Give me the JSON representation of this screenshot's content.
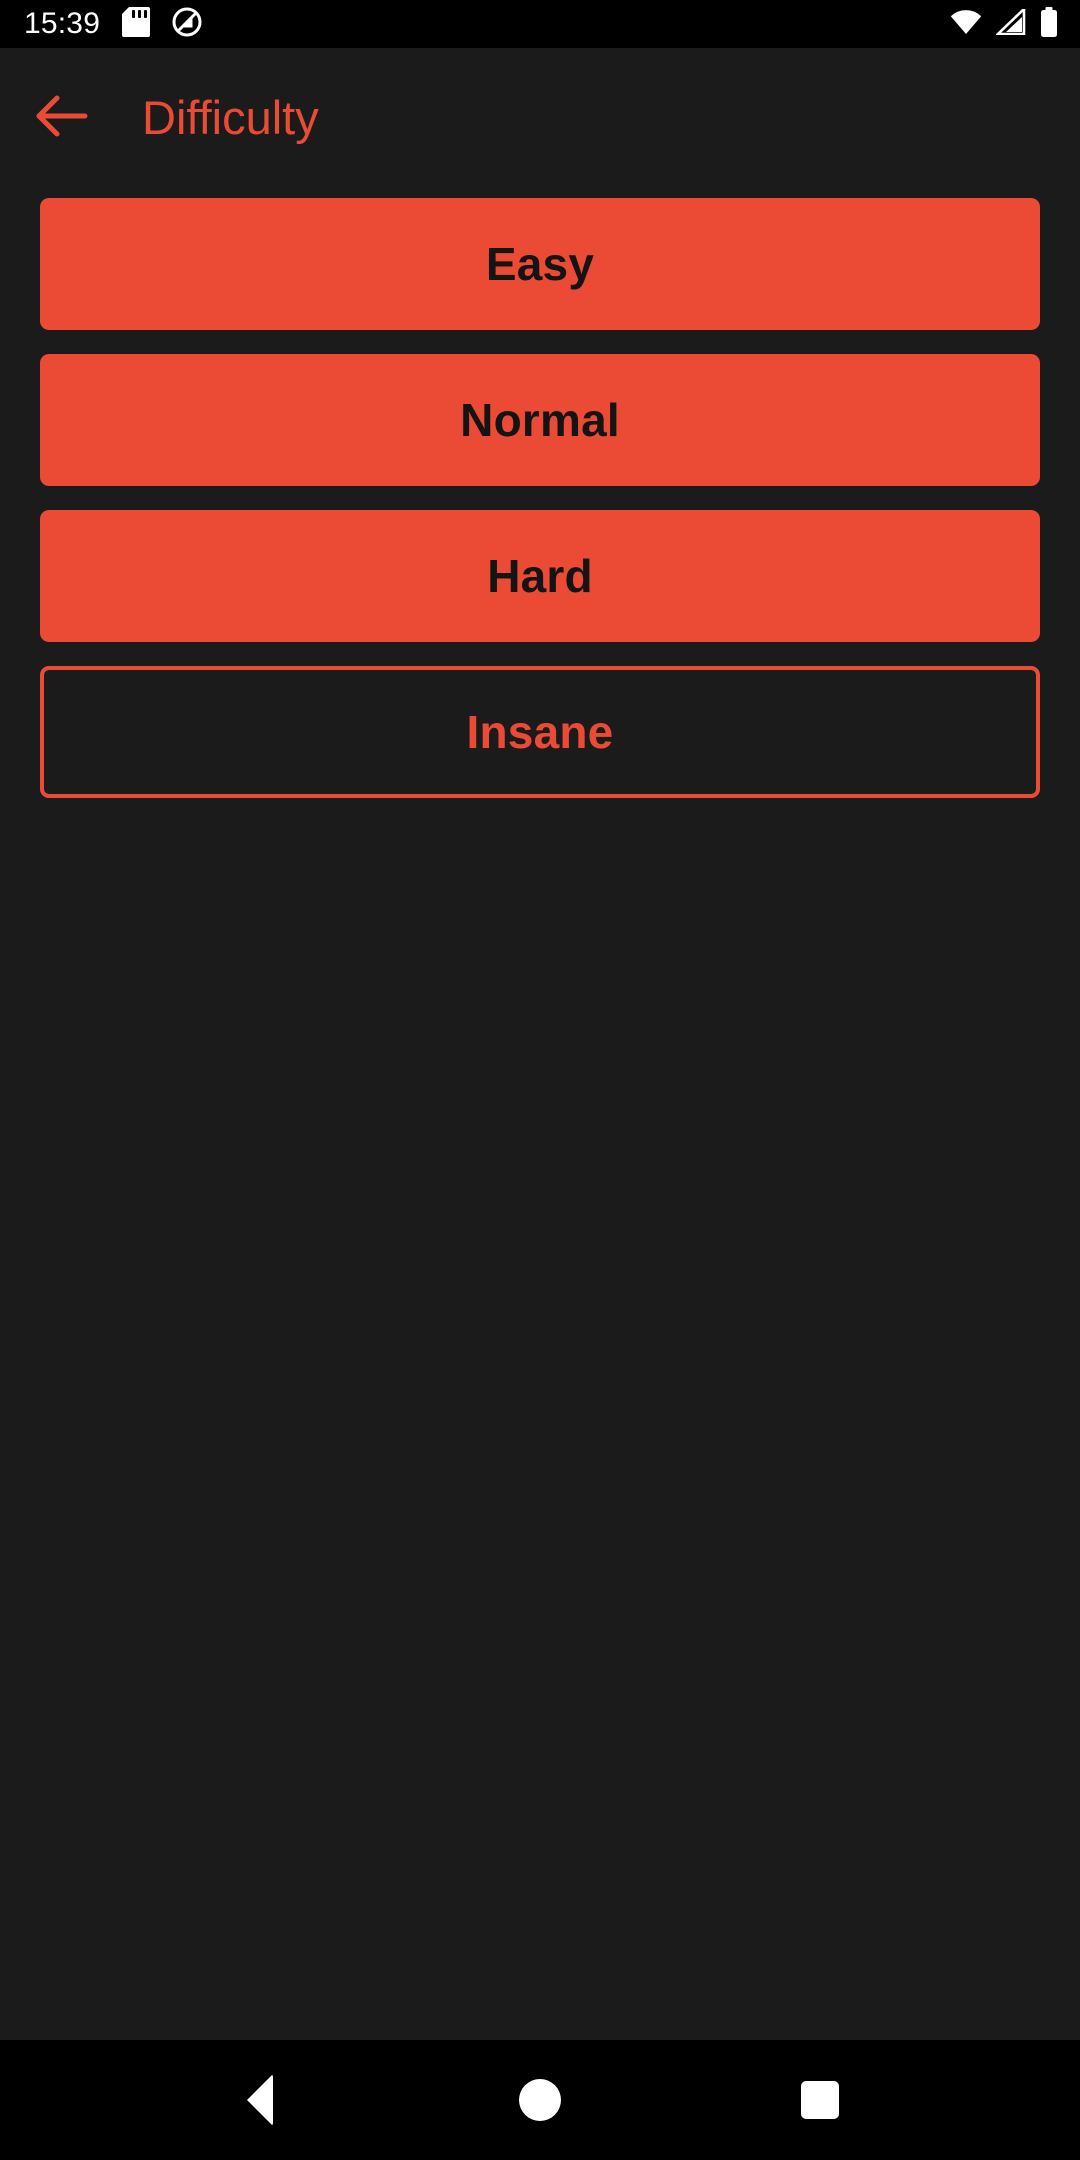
{
  "status_bar": {
    "time": "15:39",
    "left_icons": [
      "sd-card-icon",
      "do-not-disturb-icon"
    ],
    "right_icons": [
      "wifi-icon",
      "cellular-signal-icon",
      "battery-full-icon"
    ],
    "background_color": "#000000",
    "foreground_color": "#ffffff"
  },
  "app_bar": {
    "back_icon": "arrow-left-icon",
    "title": "Difficulty",
    "title_color": "#E94B35"
  },
  "theme": {
    "background": "#1c1b1b",
    "accent": "#EB4B35",
    "on_accent_text": "#141414"
  },
  "difficulty_options": [
    {
      "label": "Easy",
      "style": "filled",
      "selected": false
    },
    {
      "label": "Normal",
      "style": "filled",
      "selected": false
    },
    {
      "label": "Hard",
      "style": "filled",
      "selected": false
    },
    {
      "label": "Insane",
      "style": "outlined",
      "selected": true
    }
  ],
  "nav_bar": {
    "back_label": "back-triangle-icon",
    "home_label": "home-circle-icon",
    "recents_label": "recents-square-icon",
    "background_color": "#000000"
  }
}
